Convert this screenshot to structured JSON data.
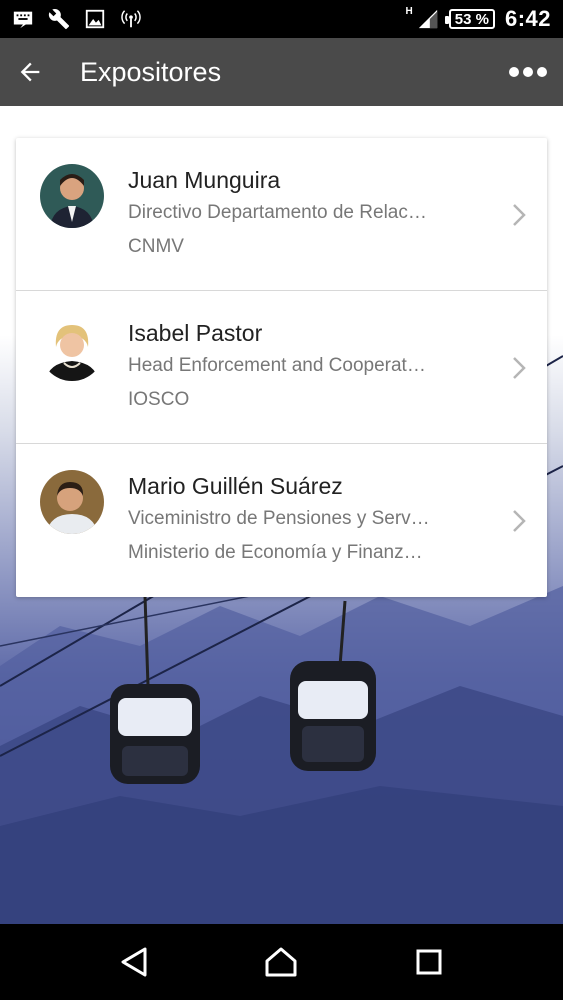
{
  "status_bar": {
    "icons": [
      "keyboard-icon",
      "wrench-icon",
      "image-icon",
      "hotspot-icon"
    ],
    "network_type": "H",
    "battery": "53 %",
    "time": "6:42"
  },
  "app_bar": {
    "title": "Expositores",
    "back_icon": "arrow-back-icon",
    "more_icon": "more-horizontal-icon"
  },
  "exhibitors": [
    {
      "name": "Juan Munguira",
      "role": "Directivo Departamento de Relac…",
      "org": "CNMV"
    },
    {
      "name": "Isabel Pastor",
      "role": "Head Enforcement and Cooperat…",
      "org": "IOSCO"
    },
    {
      "name": "Mario Guillén Suárez",
      "role": "Viceministro de Pensiones y Serv…",
      "org": "Ministerio de Economía y Finanz…"
    }
  ],
  "nav_bar": {
    "icons": [
      "back-triangle-icon",
      "home-icon",
      "recents-square-icon"
    ]
  },
  "colors": {
    "app_bar": "#4a4a4a",
    "status_bar": "#000000",
    "background_blue": "#4a569a"
  }
}
